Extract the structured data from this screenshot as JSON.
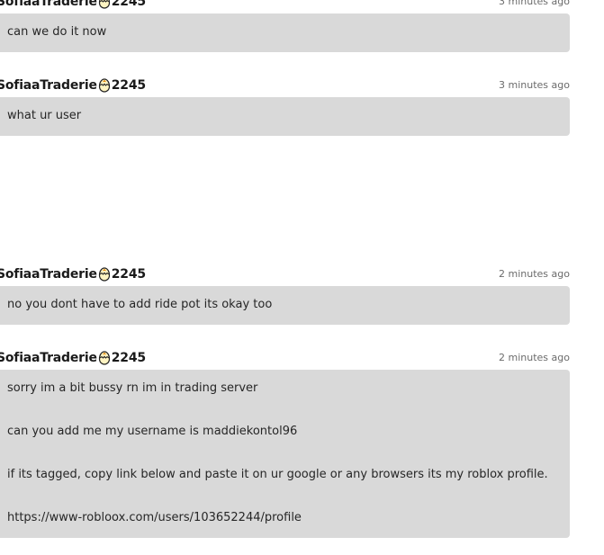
{
  "messages": [
    {
      "author_name": "SofiaaTraderie",
      "author_tag": "2245",
      "author_badge_icon": "egg-chick-icon",
      "time": "3 minutes ago",
      "lines": [
        "can we do it now"
      ]
    },
    {
      "author_name": "SofiaaTraderie",
      "author_tag": "2245",
      "author_badge_icon": "egg-chick-icon",
      "time": "3 minutes ago",
      "lines": [
        "what ur user"
      ]
    },
    {
      "author_name": "SofiaaTraderie",
      "author_tag": "2245",
      "author_badge_icon": "egg-chick-icon",
      "time": "2 minutes ago",
      "lines": [
        "no you dont have to add ride pot its okay too"
      ]
    },
    {
      "author_name": "SofiaaTraderie",
      "author_tag": "2245",
      "author_badge_icon": "egg-chick-icon",
      "time": "2 minutes ago",
      "lines": [
        "sorry im a bit bussy rn im in trading server",
        "can you add me my username is maddiekontol96",
        "if its tagged, copy link below and paste it on ur google or any browsers its my roblox profile.",
        "https://www-robloox.com/users/103652244/profile"
      ]
    }
  ],
  "colors": {
    "bubble_bg": "#d9d9d9",
    "timestamp": "#6b6b6b",
    "author": "#1a1a1a"
  }
}
